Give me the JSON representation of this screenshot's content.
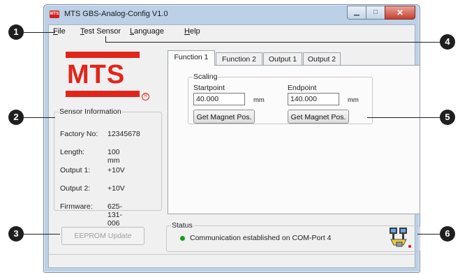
{
  "window": {
    "title": "MTS GBS-Analog-Config V1.0",
    "app_icon_label": "MTS"
  },
  "menu": {
    "items": [
      {
        "label": "File"
      },
      {
        "label": "Test Sensor"
      },
      {
        "label": "Language"
      },
      {
        "label": "Help"
      }
    ]
  },
  "logo": {
    "text": "MTS",
    "mark": "®",
    "color": "#e2251b"
  },
  "sensor_info": {
    "legend": "Sensor Information",
    "rows": [
      {
        "label": "Factory No:",
        "value": "12345678"
      },
      {
        "label": "Length:",
        "value": "100 mm"
      },
      {
        "label": "Output 1:",
        "value": "+10V"
      },
      {
        "label": "Output 2:",
        "value": "+10V"
      },
      {
        "label": "Firmware:",
        "value": "625-131-006"
      }
    ]
  },
  "eeprom_button": {
    "label": "EEPROM Update",
    "enabled": false
  },
  "tabs": [
    {
      "label": "Function 1",
      "active": true
    },
    {
      "label": "Function 2",
      "active": false
    },
    {
      "label": "Output 1",
      "active": false
    },
    {
      "label": "Output 2",
      "active": false
    }
  ],
  "scaling": {
    "legend": "Scaling",
    "start_label": "Startpoint",
    "start_value": "40.000",
    "end_label": "Endpoint",
    "end_value": "140.000",
    "unit": "mm",
    "get_magnet_label": "Get Magnet Pos."
  },
  "status": {
    "legend": "Status",
    "message": "Communication established on COM-Port 4",
    "led_color": "#1a9b1a",
    "icon": "network-computers-icon"
  },
  "callouts": [
    "1",
    "2",
    "3",
    "4",
    "5",
    "6"
  ]
}
